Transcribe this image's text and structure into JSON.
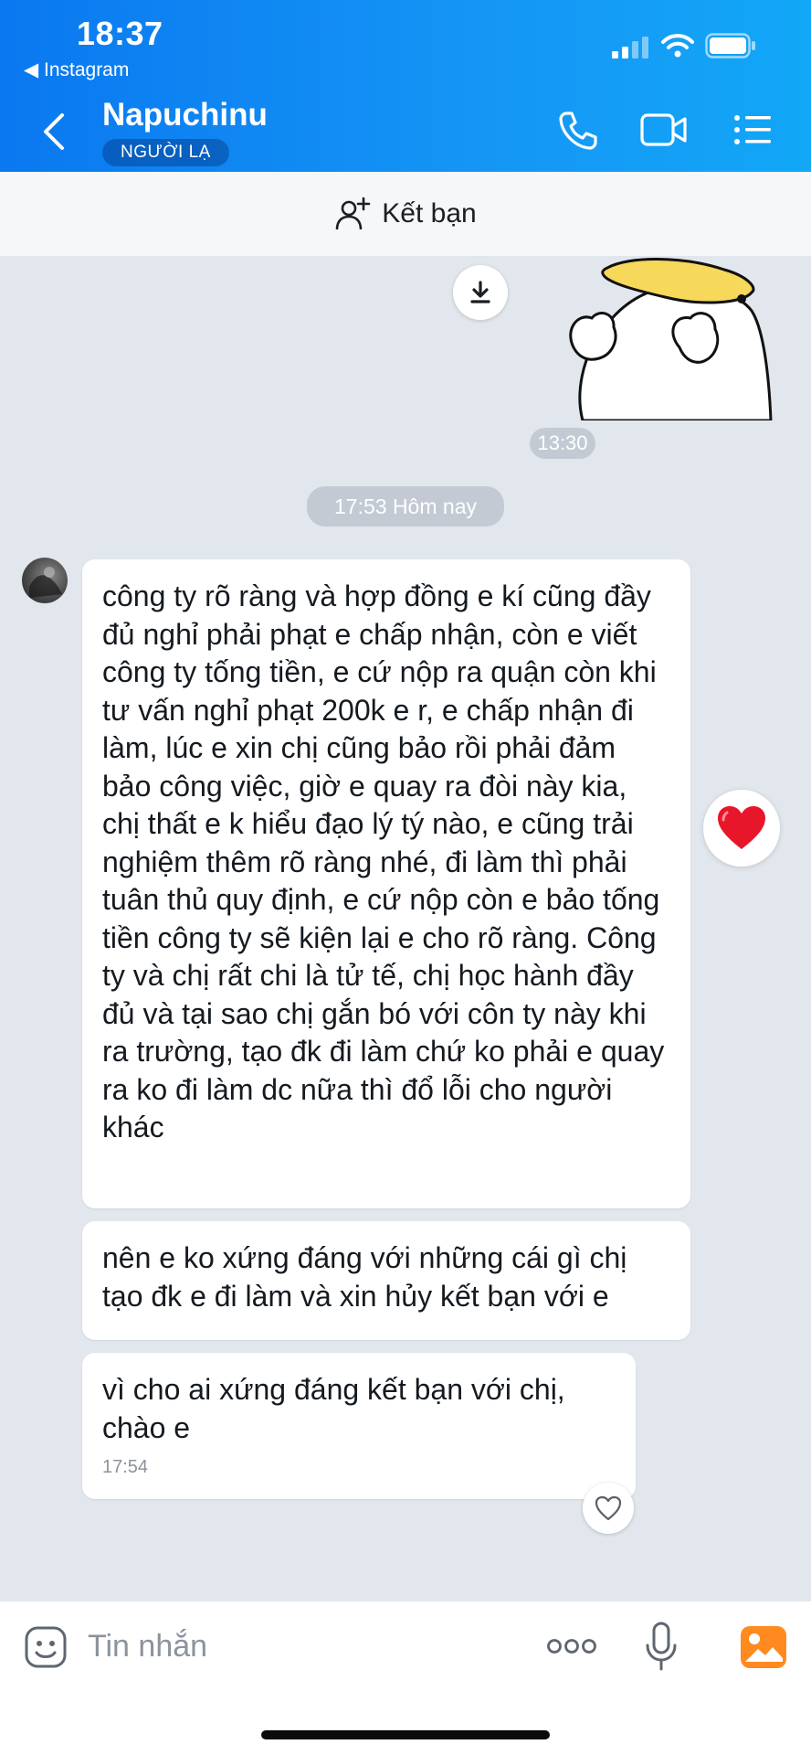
{
  "status_bar": {
    "time": "18:37",
    "back_app": "Instagram"
  },
  "header": {
    "contact_name": "Napuchinu",
    "badge": "NGƯỜI LẠ"
  },
  "friend_bar": {
    "label": "Kết bạn"
  },
  "timestamps": {
    "sticker_time": "13:30",
    "date_separator": "17:53 Hôm nay"
  },
  "messages": [
    {
      "text": "công ty rõ ràng và hợp đồng e kí cũng đầy đủ nghỉ phải phạt e chấp nhận, còn e viết công ty tống tiền, e cứ nộp ra quận còn khi tư vấn nghỉ phạt 200k e r, e chấp nhận đi làm, lúc e xin chị cũng bảo rồi phải đảm bảo công việc, giờ e quay ra đòi này kia, chị thất e k hiểu đạo lý tý nào, e cũng trải nghiệm thêm rõ ràng nhé, đi làm thì phải tuân thủ quy định, e cứ nộp còn e bảo tống tiền công ty sẽ kiện lại e cho rõ ràng. Công ty và chị rất chi là tử tế, chị học hành đầy đủ và tại sao chị gắn bó với côn ty này khi ra trường, tạo đk đi làm chứ ko phải e quay ra ko đi làm dc nữa thì đổ lỗi cho người khác"
    },
    {
      "text": "nên e ko xứng đáng với những cái gì chị tạo đk e đi làm và xin hủy kết bạn với e"
    },
    {
      "text": "vì cho ai xứng đáng kết bạn với chị, chào e",
      "time": "17:54"
    }
  ],
  "composer": {
    "placeholder": "Tin nhắn"
  },
  "icons": {
    "back": "chevron-left-icon",
    "phone": "phone-icon",
    "video": "video-camera-icon",
    "menu": "list-menu-icon",
    "add_friend": "user-plus-icon",
    "download": "download-icon",
    "reaction": "heart-icon",
    "sticker": "sticker-face-icon",
    "more": "ellipsis-icon",
    "mic": "microphone-icon",
    "gallery": "image-gallery-icon"
  },
  "colors": {
    "header_start": "#0a78f0",
    "header_end": "#12a7f7",
    "chat_bg": "#e2e7ee",
    "heart": "#e8162a",
    "gallery": "#ff8a1f"
  }
}
